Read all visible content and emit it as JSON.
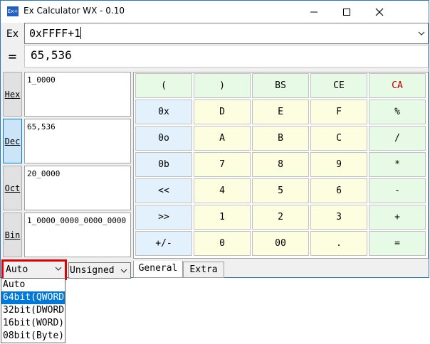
{
  "window": {
    "title": "Ex Calculator WX - 0.10",
    "icon_text": "Ex+"
  },
  "expression": {
    "label": "Ex",
    "value": "0xFFFF+1"
  },
  "result": {
    "label": "=",
    "value": "65,536"
  },
  "radix": [
    {
      "label": "Hex",
      "value": "1_0000",
      "active": false
    },
    {
      "label": "Dec",
      "value": "65,536",
      "active": true
    },
    {
      "label": "Oct",
      "value": "20_0000",
      "active": false
    },
    {
      "label": "Bin",
      "value": "1_0000_0000_0000_0000",
      "active": false
    }
  ],
  "keypad": [
    [
      "(",
      ")",
      "BS",
      "CE",
      "CA"
    ],
    [
      "0x",
      "D",
      "E",
      "F",
      "%"
    ],
    [
      "0o",
      "A",
      "B",
      "C",
      "/"
    ],
    [
      "0b",
      "7",
      "8",
      "9",
      "*"
    ],
    [
      "<<",
      "4",
      "5",
      "6",
      "-"
    ],
    [
      ">>",
      "1",
      "2",
      "3",
      "+"
    ],
    [
      "+/-",
      "0",
      "00",
      ".",
      "="
    ]
  ],
  "bitwidth_select": {
    "value": "Auto"
  },
  "sign_select": {
    "value": "Unsigned"
  },
  "tabs": [
    {
      "label": "General",
      "active": true
    },
    {
      "label": "Extra",
      "active": false
    }
  ],
  "dropdown_options": [
    {
      "label": "Auto",
      "selected": false
    },
    {
      "label": "64bit(QWORD)",
      "selected": true
    },
    {
      "label": "32bit(DWORD)",
      "selected": false
    },
    {
      "label": "16bit(WORD)",
      "selected": false
    },
    {
      "label": "08bit(Byte)",
      "selected": false
    }
  ],
  "colors": {
    "accent": "#0078d7",
    "highlight_border": "#e00000",
    "key_green": "#e6fae6",
    "key_yellow": "#fdfde0",
    "key_blue": "#e3f1fd",
    "ca_text": "#c00000"
  }
}
